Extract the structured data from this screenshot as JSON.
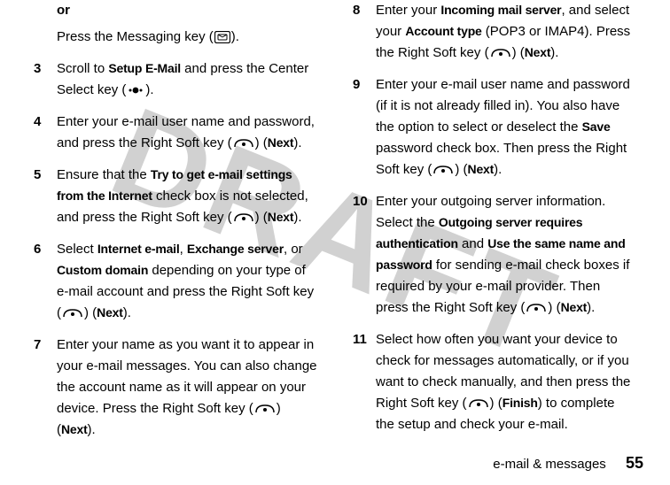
{
  "watermark": "DRAFT",
  "intro": {
    "or": "or",
    "or_body_pre": "Press the Messaging key (",
    "or_body_post": ")."
  },
  "steps": [
    {
      "n": "3",
      "parts": [
        "Scroll to ",
        {
          "b": "Setup E-Mail"
        },
        " and press the Center Select key (",
        {
          "icon": "center"
        },
        ")."
      ]
    },
    {
      "n": "4",
      "parts": [
        "Enter your e-mail user name and password, and press the Right Soft key (",
        {
          "icon": "soft"
        },
        ") (",
        {
          "b": "Next"
        },
        ")."
      ]
    },
    {
      "n": "5",
      "parts": [
        "Ensure that the ",
        {
          "b": "Try to get e-mail settings from the Internet"
        },
        " check box is not selected, and press the Right Soft key (",
        {
          "icon": "soft"
        },
        ") (",
        {
          "b": "Next"
        },
        ")."
      ]
    },
    {
      "n": "6",
      "parts": [
        "Select ",
        {
          "b": "Internet e-mail"
        },
        ", ",
        {
          "b": "Exchange server"
        },
        ", or ",
        {
          "b": "Custom domain"
        },
        " depending on your type of e-mail account and press the Right Soft key (",
        {
          "icon": "soft"
        },
        ") (",
        {
          "b": "Next"
        },
        ")."
      ]
    },
    {
      "n": "7",
      "parts": [
        "Enter your name as you want it to appear in your e-mail messages. You can also change the account name as it will appear on your device. Press the Right Soft key (",
        {
          "icon": "soft"
        },
        ") (",
        {
          "b": "Next"
        },
        ")."
      ]
    },
    {
      "n": "8",
      "parts": [
        "Enter your ",
        {
          "b": "Incoming mail server"
        },
        ", and select your ",
        {
          "b": "Account type"
        },
        " (POP3 or IMAP4). Press the Right Soft key (",
        {
          "icon": "soft"
        },
        ") (",
        {
          "b": "Next"
        },
        ")."
      ]
    },
    {
      "n": "9",
      "parts": [
        "Enter your e-mail user name and password (if it is not already filled in). You also have the option to select or deselect the ",
        {
          "b": "Save"
        },
        " password check box. Then press the Right Soft key (",
        {
          "icon": "soft"
        },
        ") (",
        {
          "b": "Next"
        },
        ")."
      ]
    },
    {
      "n": "10",
      "parts": [
        "Enter your outgoing server information. Select the ",
        {
          "b": "Outgoing server requires authentication"
        },
        " and ",
        {
          "b": "Use the same name and password"
        },
        " for sending e-mail check boxes if required by your e-mail provider. Then press the Right Soft key (",
        {
          "icon": "soft"
        },
        ") (",
        {
          "b": "Next"
        },
        ")."
      ]
    },
    {
      "n": "11",
      "parts": [
        "Select how often you want your device to check for messages automatically, or if you want to check manually, and then press the Right Soft key (",
        {
          "icon": "soft"
        },
        ") (",
        {
          "b": "Finish"
        },
        ") to complete the setup and check your e-mail."
      ]
    }
  ],
  "footer": {
    "section": "e-mail & messages",
    "page": "55"
  },
  "icons": {
    "msg": "msg-key-icon",
    "center": "center-select-key-icon",
    "soft": "right-soft-key-icon"
  }
}
